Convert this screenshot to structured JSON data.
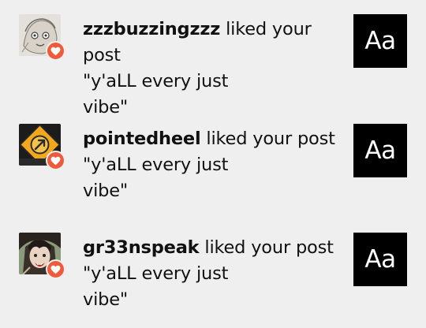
{
  "notifications": [
    {
      "username": "zzzbuzzingzzz",
      "action": " liked your post",
      "post_line1": "\"y'aLL every just",
      "post_line2": "vibe\"",
      "thumb_text": "Aa",
      "avatar_icon": "sketch-avatar-icon"
    },
    {
      "username": "pointedheel",
      "action": " liked your post",
      "post_line1": "\"y'aLL every just",
      "post_line2": "vibe\"",
      "thumb_text": "Aa",
      "avatar_icon": "arrow-diamond-avatar-icon"
    },
    {
      "username": "gr33nspeak",
      "action": " liked your post",
      "post_line1": "\"y'aLL every just",
      "post_line2": "vibe\"",
      "thumb_text": "Aa",
      "avatar_icon": "dark-hair-avatar-icon"
    }
  ],
  "colors": {
    "background": "#efefef",
    "heart_badge": "#ef5a3a",
    "thumb_bg": "#000000",
    "thumb_text": "#ffffff"
  },
  "icons": {
    "badge": "heart-icon"
  }
}
